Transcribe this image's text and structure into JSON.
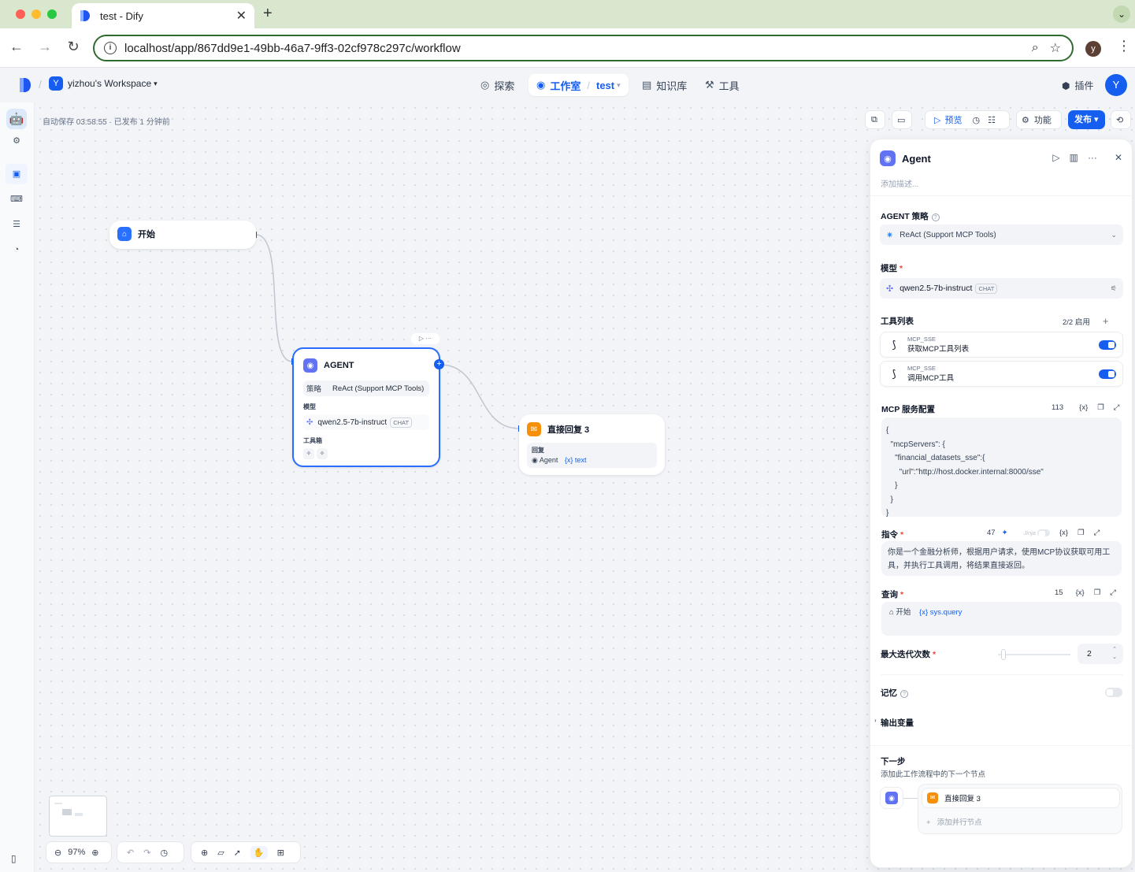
{
  "browser": {
    "tab_title": "test - Dify",
    "url": "localhost/app/867dd9e1-49bb-46a7-9ff3-02cf978c297c/workflow",
    "profile_initial": "y"
  },
  "app_header": {
    "workspace_initial": "Y",
    "workspace_name": "yizhou's Workspace",
    "nav": {
      "explore": "探索",
      "studio": "工作室",
      "app_name": "test",
      "knowledge": "知识库",
      "tools": "工具"
    },
    "plugins": "插件",
    "user_initial": "Y"
  },
  "canvas": {
    "autosave": "自动保存 03:58:55 · 已发布 1 分钟前",
    "toolbar": {
      "preview": "预览",
      "features": "功能",
      "publish": "发布"
    },
    "zoom": "97%",
    "nodes": {
      "start": {
        "title": "开始"
      },
      "agent": {
        "title": "AGENT",
        "strategy_label": "策略",
        "strategy_value": "ReAct (Support MCP Tools)",
        "model_label": "模型",
        "model_value": "qwen2.5-7b-instruct",
        "model_tag": "CHAT",
        "toolbox_label": "工具箱"
      },
      "reply": {
        "title": "直接回复 3",
        "reply_label": "回复",
        "reply_source": "Agent",
        "reply_var": "{x} text"
      }
    }
  },
  "panel": {
    "title": "Agent",
    "description_placeholder": "添加描述...",
    "strategy": {
      "label": "AGENT 策略",
      "value": "ReAct (Support MCP Tools)"
    },
    "model": {
      "label": "模型",
      "value": "qwen2.5-7b-instruct",
      "tag": "CHAT"
    },
    "tool_list": {
      "label": "工具列表",
      "enabled_count": "2/2 启用",
      "items": [
        {
          "provider": "MCP_SSE",
          "name": "获取MCP工具列表",
          "enabled": true
        },
        {
          "provider": "MCP_SSE",
          "name": "调用MCP工具",
          "enabled": true
        }
      ]
    },
    "mcp_config": {
      "label": "MCP 服务配置",
      "count": "113",
      "code": "{\n  \"mcpServers\": {\n    \"financial_datasets_sse\":{\n      \"url\":\"http://host.docker.internal:8000/sse\"\n    }\n  }\n}"
    },
    "instruction": {
      "label": "指令",
      "count": "47",
      "jinja": "Jinja",
      "text": "你是一个金融分析师，根据用户请求，使用MCP协议获取可用工具，并执行工具调用，将结果直接返回。"
    },
    "query": {
      "label": "查询",
      "count": "15",
      "source": "开始",
      "var": "{x} sys.query"
    },
    "max_iterations": {
      "label": "最大迭代次数",
      "value": "2",
      "slider_fraction": 0.05
    },
    "memory": {
      "label": "记忆",
      "enabled": false
    },
    "output_vars": {
      "label": "输出变量"
    },
    "next_step": {
      "title": "下一步",
      "description": "添加此工作流程中的下一个节点",
      "node": "直接回复 3",
      "add_parallel": "添加并行节点"
    }
  }
}
